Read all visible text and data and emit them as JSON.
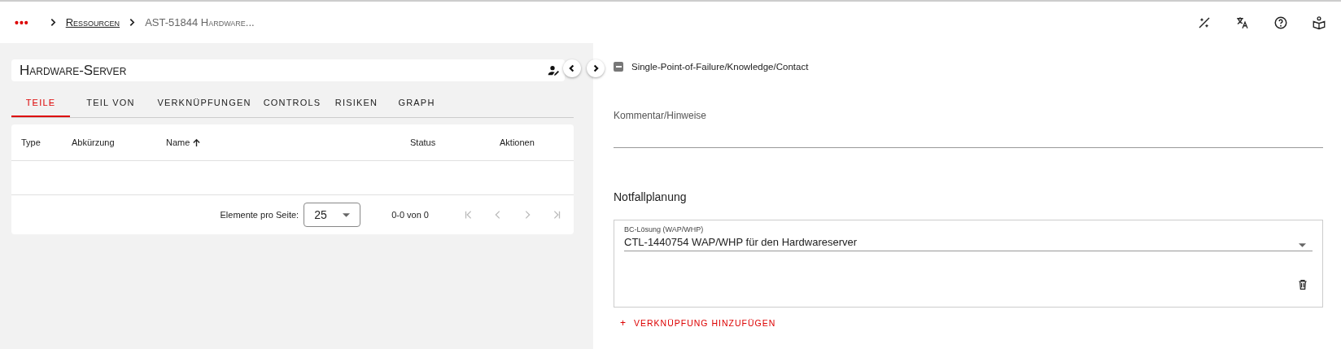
{
  "breadcrumb": {
    "more": "•••",
    "items": [
      {
        "label": "Ressourcen",
        "link": true
      },
      {
        "label": "AST-51844 Hardware...",
        "link": false
      }
    ]
  },
  "card": {
    "title": "Hardware-Server"
  },
  "tabs": [
    {
      "label": "TEILE",
      "selected": true
    },
    {
      "label": "TEIL VON",
      "selected": false
    },
    {
      "label": "VERKNÜPFUNGEN",
      "selected": false
    },
    {
      "label": "CONTROLS",
      "selected": false
    },
    {
      "label": "RISIKEN",
      "selected": false
    },
    {
      "label": "GRAPH",
      "selected": false
    }
  ],
  "table": {
    "columns": [
      {
        "label": "Type",
        "sorted": false
      },
      {
        "label": "Abkürzung",
        "sorted": false
      },
      {
        "label": "Name",
        "sorted": true
      },
      {
        "label": "Status",
        "sorted": false
      },
      {
        "label": "Aktionen",
        "sorted": false
      }
    ]
  },
  "paginator": {
    "label": "Elemente pro Seite:",
    "page_size": "25",
    "range": "0-0 von 0"
  },
  "checkbox": {
    "label": "Single-Point-of-Failure/Knowledge/Contact",
    "indeterminate": true
  },
  "comment": {
    "placeholder": "Kommentar/Hinweise"
  },
  "section": {
    "title": "Notfallplanung"
  },
  "link_field": {
    "label": "BC-Lösung (WAP/WHP)",
    "value": "CTL-1440754 WAP/WHP für den Hardwareserver"
  },
  "add_link": {
    "icon": "+",
    "label": "VERKNÜPFUNG HINZUFÜGEN"
  }
}
